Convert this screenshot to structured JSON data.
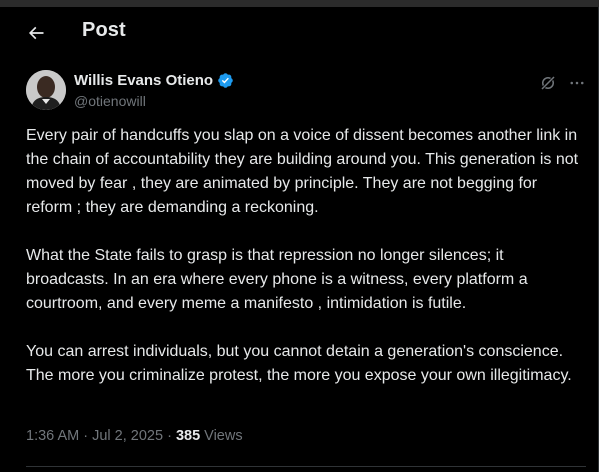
{
  "header": {
    "title": "Post"
  },
  "post": {
    "author": {
      "display_name": "Willis Evans Otieno",
      "handle": "@otienowill",
      "verified": true
    },
    "paragraphs": [
      "Every pair of handcuffs you slap on a voice of dissent becomes another link in the chain of accountability they are building around you. This generation is not moved by fear ,  they are animated by principle. They are not begging for reform ; they are demanding a reckoning.",
      "What the State fails to grasp is that repression no longer silences; it broadcasts. In an era where every phone is a witness, every platform a courtroom, and every meme a manifesto , intimidation is futile.",
      "You can arrest individuals, but you cannot detain a generation's conscience. The more you criminalize protest, the more you expose your own illegitimacy."
    ],
    "time": "1:36 AM",
    "date": "Jul 2, 2025",
    "separator": " · ",
    "views_count": "385",
    "views_label": "Views"
  },
  "colors": {
    "background": "#000000",
    "text": "#e7e9ea",
    "secondary": "#71767b",
    "verified": "#1d9bf0",
    "divider": "#2f3336"
  },
  "icons": {
    "back": "arrow-left-icon",
    "verified": "verified-badge-icon",
    "grok": "grok-icon",
    "more": "more-horizontal-icon"
  }
}
